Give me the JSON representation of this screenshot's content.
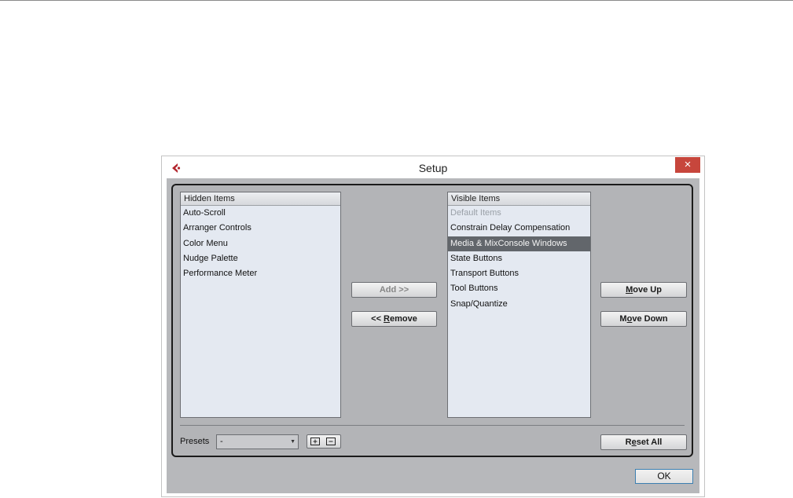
{
  "window": {
    "title": "Setup",
    "close_label": "×",
    "app_icon": "cubase-logo-icon"
  },
  "hidden_list": {
    "header": "Hidden Items",
    "items": [
      "Auto-Scroll",
      "Arranger Controls",
      "Color Menu",
      "Nudge Palette",
      "Performance Meter"
    ]
  },
  "visible_list": {
    "header": "Visible Items",
    "items": [
      {
        "label": "Default Items",
        "state": "disabled"
      },
      {
        "label": "Constrain Delay Compensation",
        "state": "normal"
      },
      {
        "label": "Media & MixConsole Windows",
        "state": "selected"
      },
      {
        "label": "State Buttons",
        "state": "normal"
      },
      {
        "label": "Transport Buttons",
        "state": "normal"
      },
      {
        "label": "Tool Buttons",
        "state": "normal"
      },
      {
        "label": "Snap/Quantize",
        "state": "normal"
      }
    ]
  },
  "buttons": {
    "add": "Add >>",
    "remove_prefix": "<< ",
    "remove_accel": "R",
    "remove_rest": "emove",
    "moveup_accel": "M",
    "moveup_rest": "ove Up",
    "movedown_prefix": "M",
    "movedown_accel": "o",
    "movedown_rest": "ve Down",
    "resetall_prefix": "R",
    "resetall_accel": "e",
    "resetall_rest": "set All",
    "ok": "OK"
  },
  "presets": {
    "label": "Presets",
    "value": "-",
    "save_icon": "save-preset-icon",
    "remove_icon": "remove-preset-icon"
  },
  "colors": {
    "close": "#c7463c",
    "selection": "#62666b",
    "logo": "#b3262e"
  }
}
